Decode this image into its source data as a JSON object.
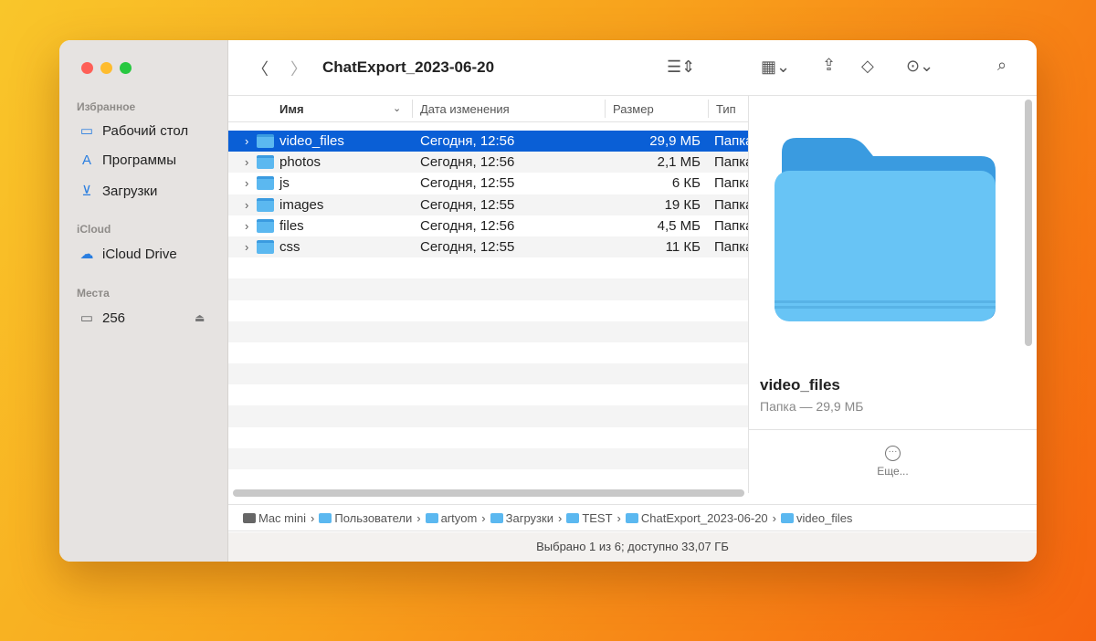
{
  "window": {
    "title": "ChatExport_2023-06-20"
  },
  "sidebar": {
    "sections": [
      {
        "label": "Избранное",
        "items": [
          {
            "label": "Рабочий стол",
            "icon": "desktop-icon"
          },
          {
            "label": "Программы",
            "icon": "apps-icon"
          },
          {
            "label": "Загрузки",
            "icon": "downloads-icon"
          }
        ]
      },
      {
        "label": "iCloud",
        "items": [
          {
            "label": "iCloud Drive",
            "icon": "cloud-icon"
          }
        ]
      },
      {
        "label": "Места",
        "items": [
          {
            "label": "256",
            "icon": "disk-icon"
          }
        ]
      }
    ]
  },
  "columns": {
    "name": "Имя",
    "date": "Дата изменения",
    "size": "Размер",
    "kind": "Тип"
  },
  "files": [
    {
      "name": "video_files",
      "date": "Сегодня, 12:56",
      "size": "29,9 МБ",
      "kind": "Папка",
      "selected": true
    },
    {
      "name": "photos",
      "date": "Сегодня, 12:56",
      "size": "2,1 МБ",
      "kind": "Папка"
    },
    {
      "name": "js",
      "date": "Сегодня, 12:55",
      "size": "6 КБ",
      "kind": "Папка"
    },
    {
      "name": "images",
      "date": "Сегодня, 12:55",
      "size": "19 КБ",
      "kind": "Папка"
    },
    {
      "name": "files",
      "date": "Сегодня, 12:56",
      "size": "4,5 МБ",
      "kind": "Папка"
    },
    {
      "name": "css",
      "date": "Сегодня, 12:55",
      "size": "11 КБ",
      "kind": "Папка"
    }
  ],
  "preview": {
    "name": "video_files",
    "meta": "Папка — 29,9 МБ",
    "more": "Еще..."
  },
  "path": [
    "Mac mini",
    "Пользователи",
    "artyom",
    "Загрузки",
    "TEST",
    "ChatExport_2023-06-20",
    "video_files"
  ],
  "status": "Выбрано 1 из 6; доступно 33,07 ГБ"
}
